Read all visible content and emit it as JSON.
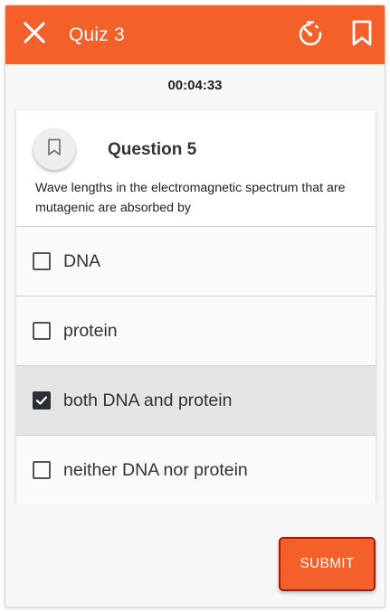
{
  "colors": {
    "accent": "#f4602a",
    "submit_border": "#9a1d12",
    "selected_bg": "#e4e4e4",
    "checkbox_checked": "#2b2f38"
  },
  "header": {
    "title": "Quiz 3",
    "close_icon": "close-icon",
    "timer_icon": "timer-icon",
    "bookmark_icon": "bookmark-icon"
  },
  "timer": {
    "elapsed": "00:04:33"
  },
  "question": {
    "bookmark_icon": "bookmark-outline-icon",
    "title": "Question 5",
    "text": "Wave lengths in the electromagnetic spectrum that are mutagenic are absorbed by",
    "options": [
      {
        "label": "DNA",
        "checked": false
      },
      {
        "label": "protein",
        "checked": false
      },
      {
        "label": "both DNA and protein",
        "checked": true
      },
      {
        "label": "neither DNA nor protein",
        "checked": false
      }
    ]
  },
  "actions": {
    "submit_label": "SUBMIT"
  }
}
